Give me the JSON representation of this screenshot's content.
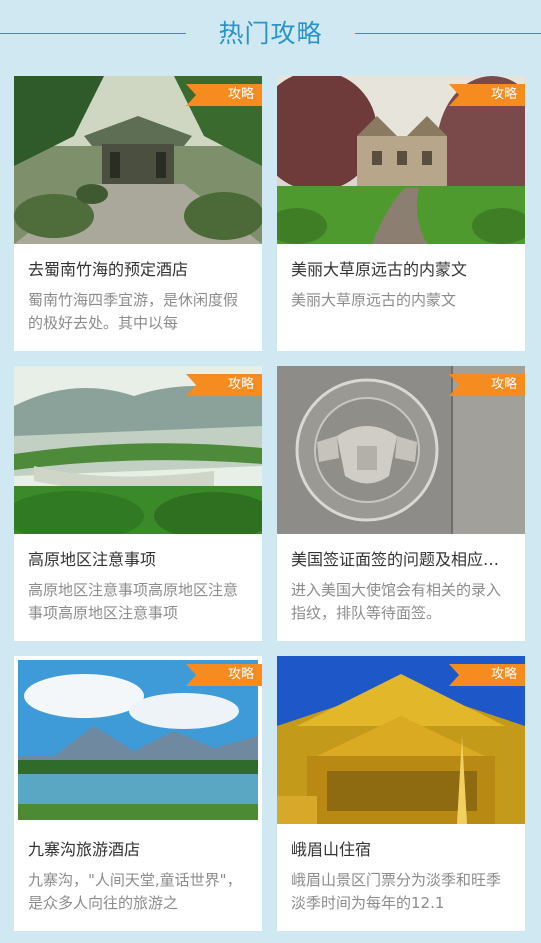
{
  "header": {
    "title": "热门攻略"
  },
  "tag_label": "攻略",
  "cards": [
    {
      "title": "去蜀南竹海的预定酒店",
      "desc": "蜀南竹海四季宜游，是休闲度假的极好去处。其中以每",
      "image": "bamboo-sea-courtyard"
    },
    {
      "title": "美丽大草原远古的内蒙文",
      "desc": "美丽大草原远古的内蒙文",
      "image": "manor-garden"
    },
    {
      "title": "高原地区注意事项",
      "desc": "高原地区注意事项高原地区注意事项高原地区注意事项",
      "image": "river-valley"
    },
    {
      "title": "美国签证面签的问题及相应…",
      "desc": "进入美国大使馆会有相关的录入指纹，排队等待面签。",
      "image": "embassy-seal"
    },
    {
      "title": "九寨沟旅游酒店",
      "desc": " 九寨沟，\"人间天堂,童话世界\"，是众多人向往的旅游之",
      "image": "mountain-lake"
    },
    {
      "title": "峨眉山住宿",
      "desc": "峨眉山景区门票分为淡季和旺季 淡季时间为每年的12.1",
      "image": "golden-temple"
    }
  ]
}
